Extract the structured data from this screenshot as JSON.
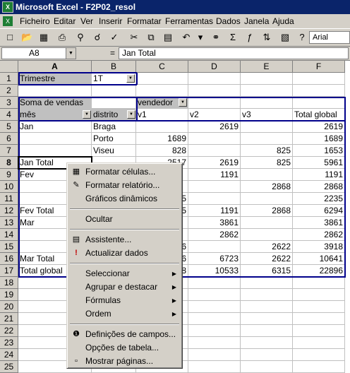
{
  "window": {
    "title": "Microsoft Excel - F2P02_resol"
  },
  "menu": {
    "items": [
      "Ficheiro",
      "Editar",
      "Ver",
      "Inserir",
      "Formatar",
      "Ferramentas",
      "Dados",
      "Janela",
      "Ajuda"
    ]
  },
  "toolbar": {
    "font_name": "Arial"
  },
  "formula_bar": {
    "cell_ref": "A8",
    "equals": "=",
    "content": "Jan Total"
  },
  "sheet": {
    "columns": [
      "A",
      "B",
      "C",
      "D",
      "E",
      "F"
    ],
    "rows": [
      "1",
      "2",
      "3",
      "4",
      "5",
      "6",
      "7",
      "8",
      "9",
      "10",
      "11",
      "12",
      "13",
      "14",
      "15",
      "16",
      "17",
      "18",
      "19",
      "20",
      "21",
      "22",
      "23",
      "24",
      "25"
    ],
    "cells": {
      "A1": "Trimestre",
      "B1": "1T",
      "A3": "Soma de vendas",
      "C3": "vendedor",
      "A4": "mês",
      "B4": "distrito",
      "C4": "v1",
      "D4": "v2",
      "E4": "v3",
      "F4": "Total global",
      "A5": "Jan",
      "B5": "Braga",
      "D5": "2619",
      "F5": "2619",
      "B6": "Porto",
      "C6": "1689",
      "F6": "1689",
      "B7": "Viseu",
      "C7": "828",
      "E7": "825",
      "F7": "1653",
      "A8": "Jan Total",
      "C8": "2517",
      "D8": "2619",
      "E8": "825",
      "F8": "5961",
      "A9": "Fev",
      "D9": "1191",
      "F9": "1191",
      "E10": "2868",
      "F10": "2868",
      "C11": "5",
      "F11": "2235",
      "A12": "Fev Total",
      "C12": "5",
      "D12": "1191",
      "E12": "2868",
      "F12": "6294",
      "A13": "Mar",
      "D13": "3861",
      "F13": "3861",
      "D14": "2862",
      "F14": "2862",
      "C15": "6",
      "E15": "2622",
      "F15": "3918",
      "A16": "Mar Total",
      "C16": "6",
      "D16": "6723",
      "E16": "2622",
      "F16": "10641",
      "A17": "Total global",
      "C17": "8",
      "D17": "10533",
      "E17": "6315",
      "F17": "22896"
    }
  },
  "context_menu": {
    "items": [
      {
        "label": "Formatar células...",
        "icon": "format-cells-icon"
      },
      {
        "label": "Formatar relatório...",
        "icon": "format-report-icon"
      },
      {
        "label": "Gráficos dinâmicos",
        "icon": ""
      },
      {
        "label": "Ocultar",
        "icon": ""
      },
      {
        "label": "Assistente...",
        "icon": "wizard-icon"
      },
      {
        "label": "Actualizar dados",
        "icon": "refresh-data-icon"
      },
      {
        "label": "Seleccionar",
        "icon": ""
      },
      {
        "label": "Agrupar e destacar",
        "icon": ""
      },
      {
        "label": "Fórmulas",
        "icon": ""
      },
      {
        "label": "Ordem",
        "icon": ""
      },
      {
        "label": "Definições de campos...",
        "icon": "field-settings-icon"
      },
      {
        "label": "Opções de tabela...",
        "icon": ""
      },
      {
        "label": "Mostrar páginas...",
        "icon": "show-pages-icon"
      }
    ]
  }
}
